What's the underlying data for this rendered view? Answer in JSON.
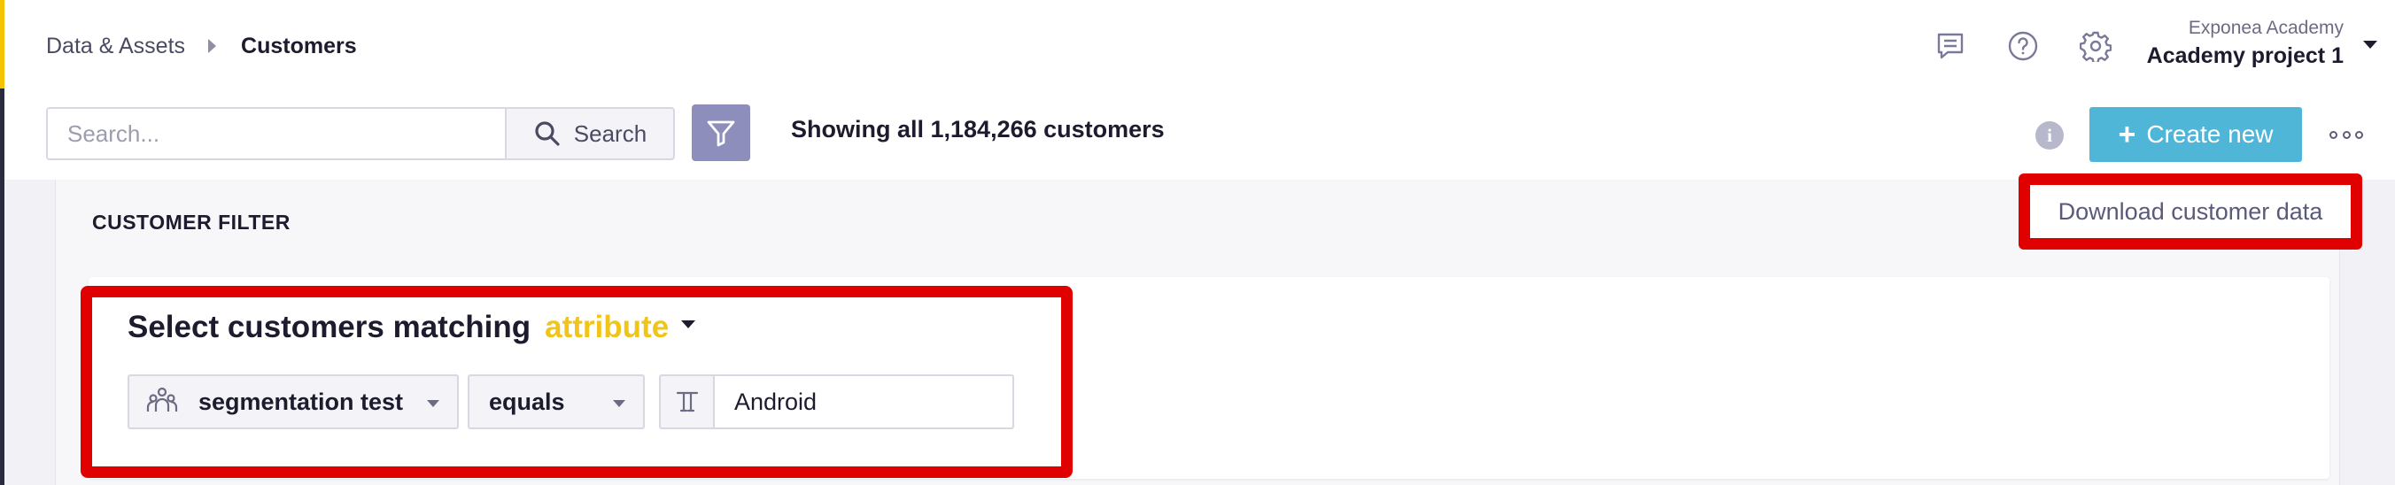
{
  "breadcrumb": {
    "parent": "Data & Assets",
    "current": "Customers"
  },
  "account": {
    "organization": "Exponea Academy",
    "project": "Academy project 1"
  },
  "header_icons": [
    "chat-icon",
    "help-icon",
    "gear-icon"
  ],
  "search": {
    "placeholder": "Search...",
    "value": "",
    "button_label": "Search"
  },
  "filter_button_icon": "funnel-icon",
  "customer_count_text": "Showing all 1,184,266 customers",
  "actions": {
    "create_label": "Create new",
    "more_icon": "ellipsis-icon",
    "info_icon": "info-icon"
  },
  "dropdown_menu": {
    "download_label": "Download customer data"
  },
  "customer_filter": {
    "title": "CUSTOMER FILTER",
    "match_prefix": "Select customers matching",
    "match_type": "attribute",
    "condition": {
      "attribute": "segmentation test",
      "attribute_icon": "segmentation-icon",
      "operator": "equals",
      "value_type_icon": "text-type-icon",
      "value": "Android"
    }
  },
  "colors": {
    "accent_yellow": "#f5c400",
    "primary_button": "#4fb6d8",
    "filter_button": "#8e8ebc",
    "highlight_red": "#e00000",
    "attribute_yellow": "#f0c419"
  }
}
